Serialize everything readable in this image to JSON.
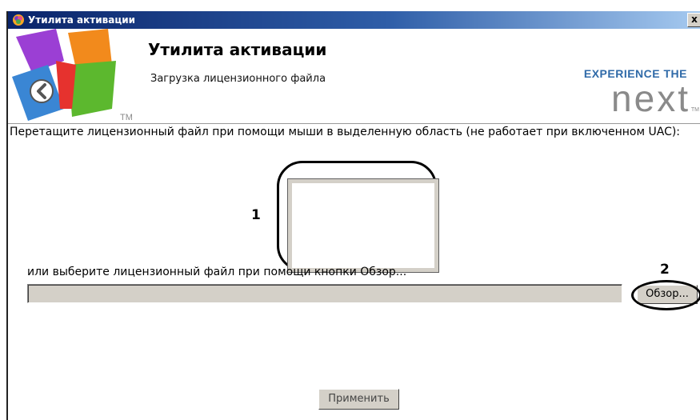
{
  "window": {
    "title": "Утилита активации",
    "close_label": "x"
  },
  "header": {
    "title": "Утилита активации",
    "subtitle": "Загрузка лицензионного файла",
    "logo_tm": "TM",
    "brand_top": "EXPERIENCE THE",
    "brand_main": "next",
    "brand_tm": "TM"
  },
  "main": {
    "instruction": "Перетащите лицензионный файл при помощи мыши в выделенную область (не работает при включенном UAC):",
    "or_text": "или выберите лицензионный файл при помощи кнопки Обзор...",
    "path_value": "",
    "browse_label": "Обзор...",
    "apply_label": "Применить"
  },
  "annotations": {
    "marker_1": "1",
    "marker_2": "2"
  },
  "colors": {
    "titlebar_start": "#0a246a",
    "titlebar_end": "#a6caf0",
    "button_face": "#d4d0c8",
    "brand_blue": "#2f6aa8",
    "brand_gray": "#8a8a8a"
  },
  "icons": {
    "app_icon": "activation-app-icon",
    "back": "back-arrow-icon"
  }
}
